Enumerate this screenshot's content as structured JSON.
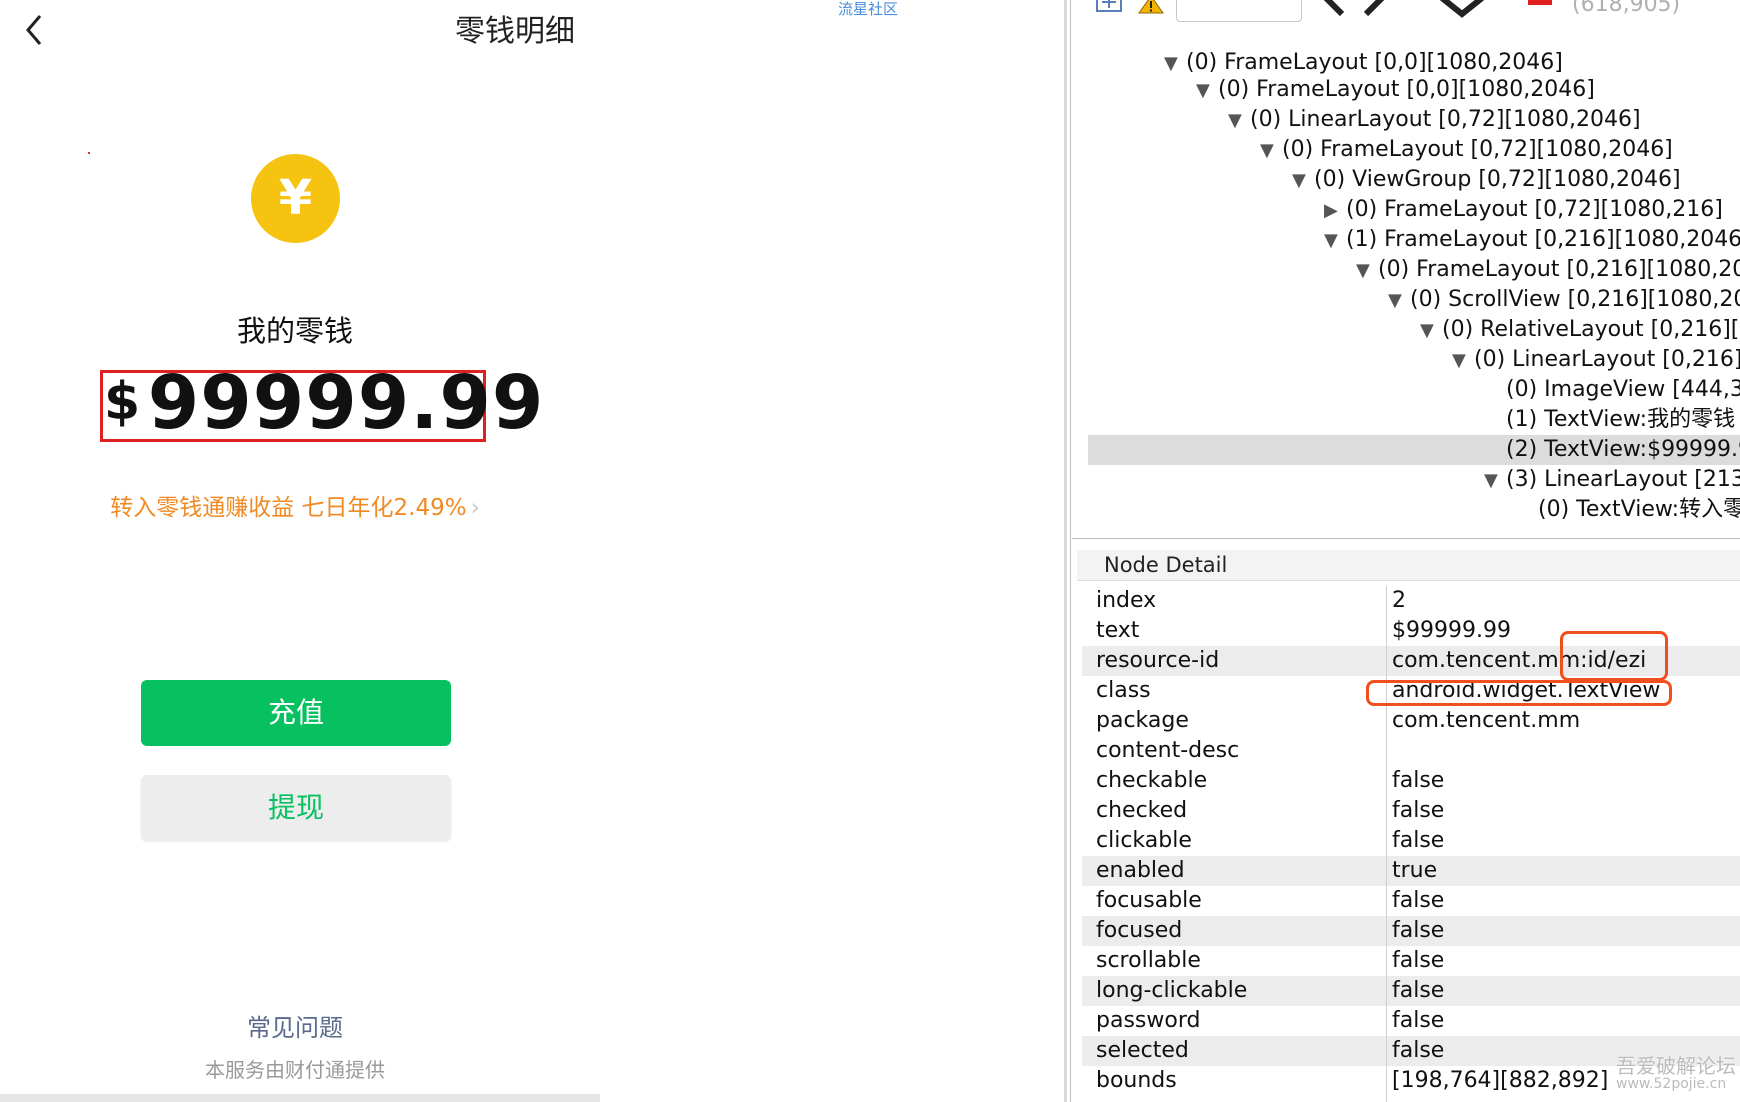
{
  "phone": {
    "nav_title": "零钱明细",
    "coin_symbol": "¥",
    "balance_label": "我的零钱",
    "currency_symbol": "$",
    "balance_amount": "99999.99",
    "promo_text": "转入零钱通赚收益 七日年化2.49%",
    "promo_chevron": "›",
    "recharge_label": "充值",
    "withdraw_label": "提现",
    "faq_label": "常见问题",
    "provider_note": "本服务由财付通提供",
    "top_watermark": "流星社区"
  },
  "inspector": {
    "toolbar": {
      "coordinate_text": "(618,905)"
    },
    "tree": [
      {
        "expander": "▼",
        "text": "(0) FrameLayout [0,0][1080,2046]"
      },
      {
        "expander": "▼",
        "text": "(0) FrameLayout [0,0][1080,2046]"
      },
      {
        "expander": "▼",
        "text": "(0) LinearLayout [0,72][1080,2046]"
      },
      {
        "expander": "▼",
        "text": "(0) FrameLayout [0,72][1080,2046]"
      },
      {
        "expander": "▼",
        "text": "(0) ViewGroup [0,72][1080,2046]"
      },
      {
        "expander": "▶",
        "text": "(0) FrameLayout [0,72][1080,216]"
      },
      {
        "expander": "▼",
        "text": "(1) FrameLayout [0,216][1080,2046]"
      },
      {
        "expander": "▼",
        "text": "(0) FrameLayout [0,216][1080,20"
      },
      {
        "expander": "▼",
        "text": "(0) ScrollView [0,216][1080,20"
      },
      {
        "expander": "▼",
        "text": "(0) RelativeLayout [0,216][1"
      },
      {
        "expander": "▼",
        "text": "(0) LinearLayout [0,216]["
      },
      {
        "expander": "",
        "text": "(0) ImageView [444,36"
      },
      {
        "expander": "",
        "text": "(1) TextView:我的零钱"
      },
      {
        "expander": "",
        "text": "(2) TextView:$99999.9",
        "selected": true
      },
      {
        "expander": "▼",
        "text": "(3) LinearLayout [213,"
      },
      {
        "expander": "",
        "text": "(0) TextView:转入零"
      }
    ],
    "detail_title": "Node Detail",
    "details": [
      {
        "key": "index",
        "value": "2"
      },
      {
        "key": "text",
        "value": "$99999.99"
      },
      {
        "key": "resource-id",
        "value": "com.tencent.mm:id/ezi"
      },
      {
        "key": "class",
        "value": "android.widget.TextView"
      },
      {
        "key": "package",
        "value": "com.tencent.mm"
      },
      {
        "key": "content-desc",
        "value": ""
      },
      {
        "key": "checkable",
        "value": "false"
      },
      {
        "key": "checked",
        "value": "false"
      },
      {
        "key": "clickable",
        "value": "false"
      },
      {
        "key": "enabled",
        "value": "true"
      },
      {
        "key": "focusable",
        "value": "false"
      },
      {
        "key": "focused",
        "value": "false"
      },
      {
        "key": "scrollable",
        "value": "false"
      },
      {
        "key": "long-clickable",
        "value": "false"
      },
      {
        "key": "password",
        "value": "false"
      },
      {
        "key": "selected",
        "value": "false"
      },
      {
        "key": "bounds",
        "value": "[198,764][882,892]"
      }
    ],
    "site_watermark": "吾爱破解论坛",
    "site_watermark_url": "www.52pojie.cn"
  },
  "colors": {
    "wechat_green": "#07c160",
    "coin_yellow": "#f6c310",
    "promo_orange": "#f08a24",
    "highlight_red": "#e02020",
    "annotation_orange": "#f0501e"
  }
}
